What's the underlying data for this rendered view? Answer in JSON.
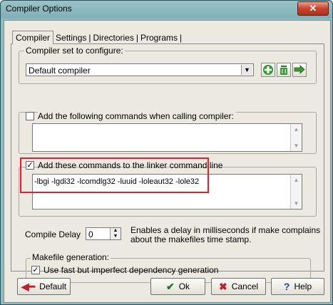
{
  "window": {
    "title": "Compiler Options",
    "close_label": "✕"
  },
  "tabs": [
    "Compiler",
    "Settings",
    "Directories",
    "Programs"
  ],
  "compiler_set": {
    "label": "Compiler set to configure:",
    "value": "Default compiler"
  },
  "compiler_commands": {
    "label": "Add the following commands when calling compiler:",
    "checked": false,
    "value": ""
  },
  "linker_commands": {
    "label": "Add these commands to the linker command line",
    "checked": true,
    "value": "-lbgi -lgdi32 -lcomdlg32 -luuid -loleaut32 -lole32"
  },
  "compile_delay": {
    "label": "Compile Delay",
    "value": "0",
    "description_line1": "Enables a delay in milliseconds if make complains",
    "description_line2": "about the makefiles time stamp."
  },
  "makefile": {
    "group_label": "Makefile generation:",
    "option_label": "Use fast but imperfect dependency generation",
    "checked": true
  },
  "buttons": {
    "default": "Default",
    "ok": "Ok",
    "cancel": "Cancel",
    "help": "Help"
  },
  "colors": {
    "highlight": "#e0202c",
    "green_icon": "#2f9a2f",
    "cancel_x": "#c0202a",
    "ok_check": "#1c7a1c"
  }
}
